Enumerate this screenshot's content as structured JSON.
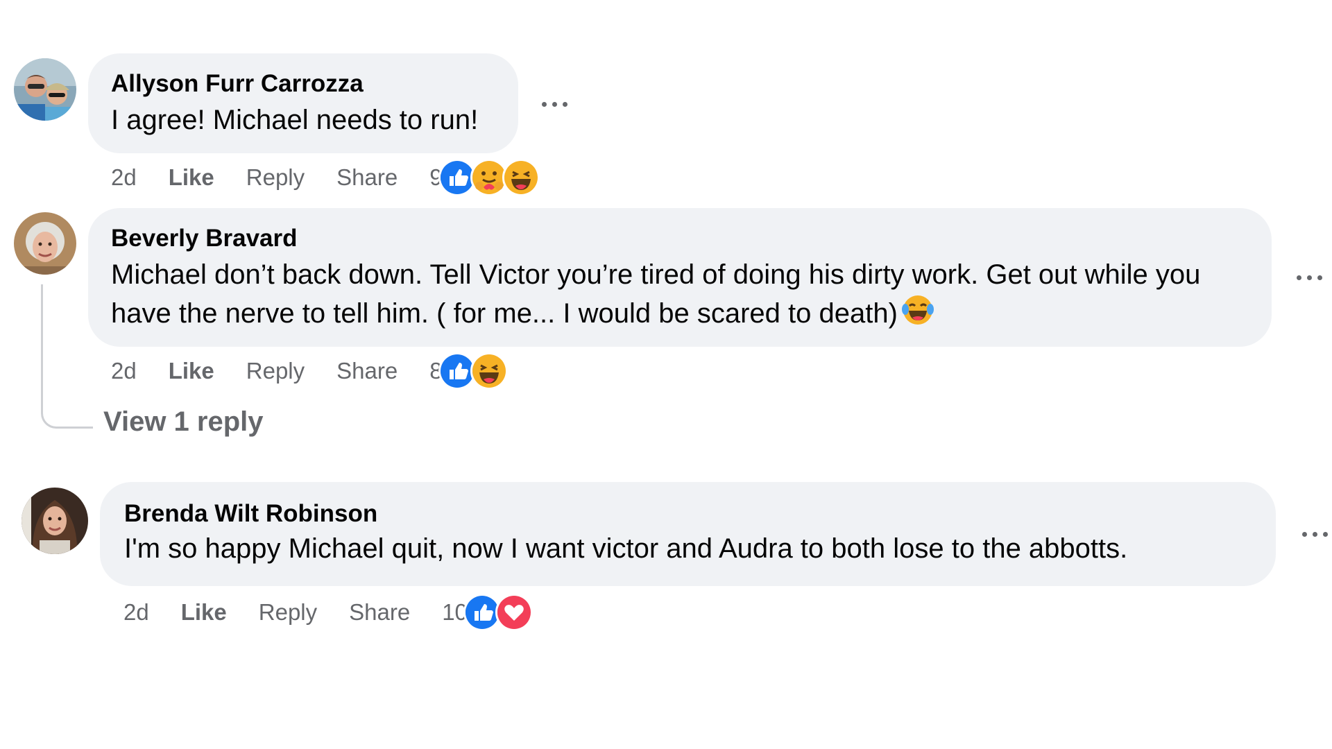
{
  "comments": [
    {
      "author": "Allyson Furr Carrozza",
      "text": "I agree! Michael needs to run!",
      "time": "2d",
      "like_label": "Like",
      "reply_label": "Reply",
      "share_label": "Share",
      "reaction_count": "9",
      "reactions": [
        "like-icon",
        "care-icon",
        "haha-icon"
      ]
    },
    {
      "author": "Beverly Bravard",
      "text": "Michael don’t back down. Tell Victor you’re tired of doing his dirty work. Get out while you have the nerve to tell him. ( for me... I would be scared to death)",
      "emoji": "laughing-tears-emoji",
      "time": "2d",
      "like_label": "Like",
      "reply_label": "Reply",
      "share_label": "Share",
      "reaction_count": "8",
      "reactions": [
        "like-icon",
        "haha-icon"
      ],
      "view_replies": "View 1 reply"
    },
    {
      "author": "Brenda Wilt Robinson",
      "text": "I'm so happy Michael quit, now I want victor and Audra to both lose to the abbotts.",
      "time": "2d",
      "like_label": "Like",
      "reply_label": "Reply",
      "share_label": "Share",
      "reaction_count": "10",
      "reactions": [
        "like-icon",
        "love-icon"
      ]
    }
  ],
  "colors": {
    "bubble": "#f0f2f5",
    "secondary_text": "#65676b",
    "like_blue": "#1877f2",
    "love_red": "#f33e58",
    "haha_yellow": "#f7b125"
  }
}
